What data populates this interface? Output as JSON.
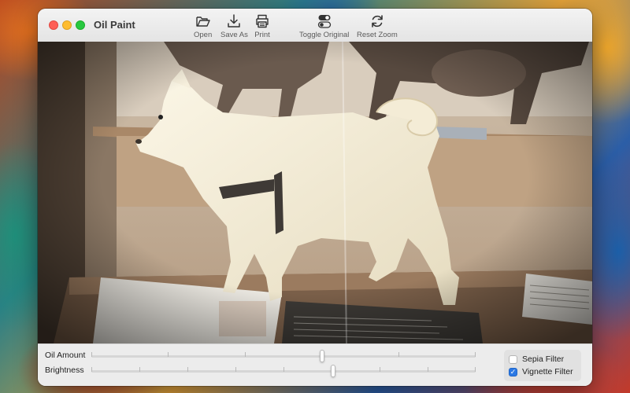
{
  "app": {
    "title": "Oil Paint"
  },
  "toolbar": {
    "items": [
      {
        "label": "Open",
        "icon": "folder-open-icon"
      },
      {
        "label": "Save As",
        "icon": "download-icon"
      },
      {
        "label": "Print",
        "icon": "printer-icon"
      },
      {
        "label": "Toggle Original",
        "icon": "toggle-switch-icon"
      },
      {
        "label": "Reset Zoom",
        "icon": "refresh-icon"
      }
    ]
  },
  "controls": {
    "oil_amount": {
      "label": "Oil Amount",
      "value_fraction": 0.6
    },
    "brightness": {
      "label": "Brightness",
      "value_fraction": 0.63
    },
    "sepia": {
      "label": "Sepia Filter",
      "checked": false
    },
    "vignette": {
      "label": "Vignette Filter",
      "checked": true,
      "check_glyph": "✓"
    }
  },
  "colors": {
    "accent": "#2b78e4",
    "close": "#fe5f57",
    "minimize": "#febc2e",
    "maximize": "#28c840"
  }
}
